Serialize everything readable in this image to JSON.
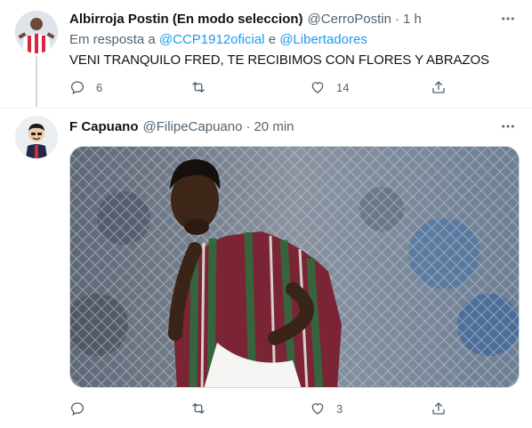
{
  "tweet1": {
    "author_name": "Albirroja Postin (En modo seleccion)",
    "handle": "@CerroPostin",
    "separator": "·",
    "time": "1 h",
    "reply_prefix": "Em resposta a",
    "reply_user1": "@CCP1912oficial",
    "reply_conj": "e",
    "reply_user2": "@Libertadores",
    "text": "VENI TRANQUILO FRED, TE RECIBIMOS CON FLORES Y ABRAZOS",
    "replies": "6",
    "retweets": "",
    "likes": "14"
  },
  "tweet2": {
    "author_name": "F Capuano",
    "handle": "@FilipeCapuano",
    "separator": "·",
    "time": "20 min",
    "replies": "",
    "retweets": "",
    "likes": "3"
  },
  "icons": {
    "more": "more-horizontal-icon",
    "reply": "speech-bubble-icon",
    "retweet": "retweet-arrows-icon",
    "like": "heart-icon",
    "share": "share-upload-icon"
  },
  "colors": {
    "text": "#0f1419",
    "secondary": "#536471",
    "link": "#1d9bf0",
    "border": "#cfd9de"
  }
}
